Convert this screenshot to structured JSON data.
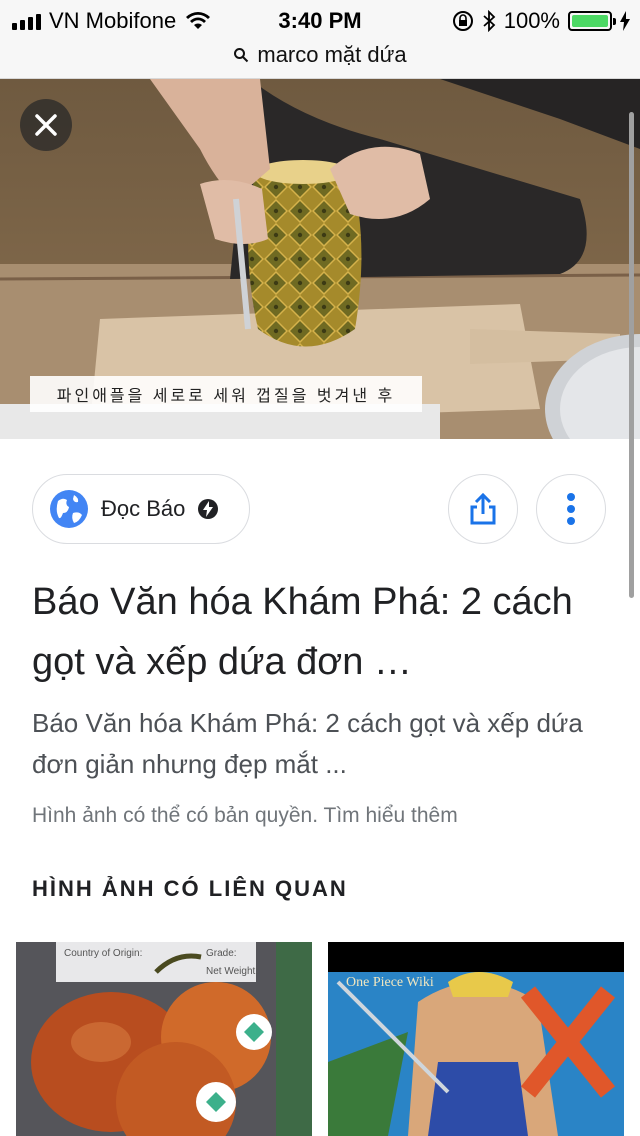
{
  "status_bar": {
    "carrier": "VN Mobifone",
    "time": "3:40 PM",
    "battery_percent": "100%",
    "battery_level": 1.0,
    "battery_color": "#4cd964"
  },
  "url_bar": {
    "query": "marco mặt dứa"
  },
  "hero": {
    "caption": "파인애플을 세로로 세워 껍질을 벗겨낸 후"
  },
  "source": {
    "name": "Đọc Báo"
  },
  "result": {
    "title": "Báo Văn hóa Khám Phá: 2 cách gọt và xếp dứa đơn …",
    "description": "Báo Văn hóa Khám Phá: 2 cách gọt và xếp dứa đơn giản nhưng đẹp mắt ...",
    "copyright_note": "Hình ảnh có thể có bản quyền.",
    "learn_more": "Tìm hiểu thêm"
  },
  "related": {
    "heading": "HÌNH ẢNH CÓ LIÊN QUAN",
    "thumb_1": {
      "label_lines": [
        "Country of Origin:",
        "Grade:",
        "Net Weight:"
      ]
    },
    "thumb_2": {
      "watermark": "One Piece Wiki"
    }
  },
  "colors": {
    "accent_blue": "#1a73e8",
    "text_primary": "#202124",
    "text_secondary": "#4d5156"
  }
}
